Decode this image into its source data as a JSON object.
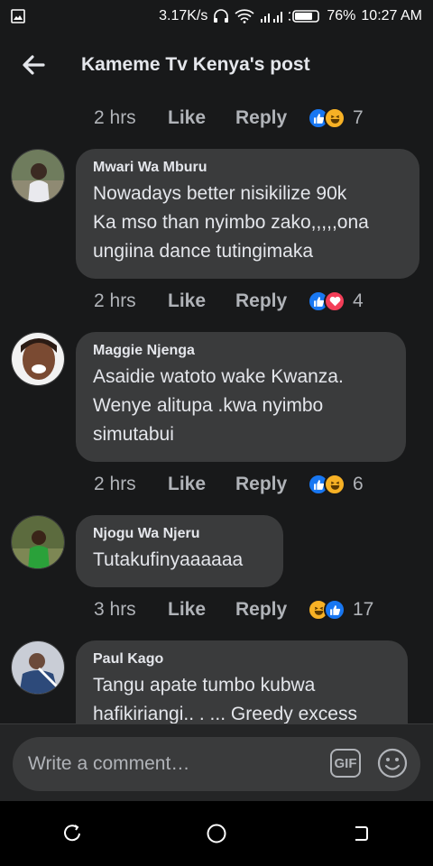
{
  "status_bar": {
    "speed": "3.17K/s",
    "battery": "76%",
    "time": "10:27 AM",
    "icons": [
      "gallery-icon",
      "headphones-icon",
      "wifi-icon",
      "signal-icon",
      "battery-icon"
    ]
  },
  "header": {
    "title": "Kameme Tv Kenya's post"
  },
  "top_meta": {
    "time": "2 hrs",
    "like": "Like",
    "reply": "Reply",
    "reactions": [
      "like",
      "haha"
    ],
    "count": "7"
  },
  "comments": [
    {
      "author": "Mwari Wa Mburu",
      "text_lines": [
        "Nowadays better nisikilize 90k",
        "Ka mso than nyimbo zako,,,,,ona",
        "ungiina dance tutingimaka"
      ],
      "time": "2 hrs",
      "like": "Like",
      "reply": "Reply",
      "reactions": [
        "like",
        "love"
      ],
      "count": "4"
    },
    {
      "author": "Maggie Njenga",
      "text_lines": [
        "Asaidie  watoto wake Kwanza.",
        "Wenye alitupa .kwa nyimbo",
        "simutabui"
      ],
      "time": "2 hrs",
      "like": "Like",
      "reply": "Reply",
      "reactions": [
        "like",
        "haha"
      ],
      "count": "6"
    },
    {
      "author": "Njogu Wa Njeru",
      "text_lines": [
        "Tutakufinyaaaaaa"
      ],
      "time": "3 hrs",
      "like": "Like",
      "reply": "Reply",
      "reactions": [
        "haha",
        "like"
      ],
      "count": "17"
    },
    {
      "author": "Paul Kago",
      "text_lines": [
        "Tangu apate tumbo kubwa",
        "hafikiriangi.. . ... Greedy excess"
      ]
    }
  ],
  "composer": {
    "placeholder": "Write a comment…",
    "gif_label": "GIF"
  },
  "colors": {
    "background": "#18191a",
    "bubble": "#3a3b3c",
    "like_blue": "#1877f2",
    "haha_yellow": "#f7b125",
    "love_red": "#f33e58"
  }
}
